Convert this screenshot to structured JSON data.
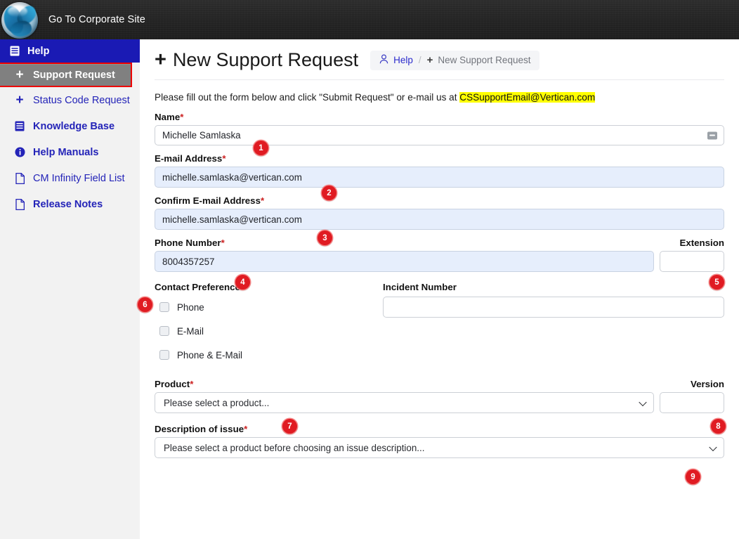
{
  "topbar": {
    "logo_icon": "vertican-sphere-logo",
    "corporate_link": "Go To Corporate Site"
  },
  "sidebar": {
    "header": {
      "label": "Help",
      "icon": "book-icon"
    },
    "items": [
      {
        "label": "Support Request",
        "icon": "plus-icon",
        "active": true,
        "bold": true
      },
      {
        "label": "Status Code Request",
        "icon": "plus-icon",
        "active": false,
        "bold": false
      },
      {
        "label": "Knowledge Base",
        "icon": "book-icon",
        "active": false,
        "bold": true
      },
      {
        "label": "Help Manuals",
        "icon": "info-icon",
        "active": false,
        "bold": true
      },
      {
        "label": "CM Infinity Field List",
        "icon": "document-icon",
        "active": false,
        "bold": false
      },
      {
        "label": "Release Notes",
        "icon": "document-icon",
        "active": false,
        "bold": true
      }
    ]
  },
  "header": {
    "title": "New Support Request",
    "title_icon": "plus-icon",
    "breadcrumb": {
      "user_icon": "person-icon",
      "parent": "Help",
      "separator": "/",
      "current_icon": "plus-icon",
      "current": "New Support Request"
    }
  },
  "form": {
    "intro_before": "Please fill out the form below and click \"Submit Request\" or e-mail us at ",
    "intro_email": "CSSupportEmail@Vertican.com",
    "name": {
      "label": "Name",
      "required": "*",
      "value": "Michelle Samlaska",
      "autofill_icon": "credentials-icon"
    },
    "email": {
      "label": "E-mail Address",
      "required": "*",
      "value": "michelle.samlaska@vertican.com"
    },
    "confirm_email": {
      "label": "Confirm E-mail Address",
      "required": "*",
      "value": "michelle.samlaska@vertican.com"
    },
    "phone": {
      "label": "Phone Number",
      "required": "*",
      "value": "8004357257"
    },
    "extension": {
      "label": "Extension",
      "value": ""
    },
    "contact_preference": {
      "label": "Contact Preference",
      "options": [
        {
          "label": "Phone",
          "checked": false
        },
        {
          "label": "E-Mail",
          "checked": false
        },
        {
          "label": "Phone & E-Mail",
          "checked": false
        }
      ]
    },
    "incident_number": {
      "label": "Incident Number",
      "value": ""
    },
    "product": {
      "label": "Product",
      "required": "*",
      "selected": "Please select a product..."
    },
    "version": {
      "label": "Version",
      "value": ""
    },
    "description": {
      "label": "Description of issue",
      "required": "*",
      "selected": "Please select a product before choosing an issue description..."
    }
  },
  "annotations": [
    {
      "n": "1",
      "target": "name-field"
    },
    {
      "n": "2",
      "target": "email-field"
    },
    {
      "n": "3",
      "target": "confirm-email-field"
    },
    {
      "n": "4",
      "target": "phone-field"
    },
    {
      "n": "5",
      "target": "extension-field"
    },
    {
      "n": "6",
      "target": "contact-preference-label"
    },
    {
      "n": "7",
      "target": "product-select"
    },
    {
      "n": "8",
      "target": "version-field"
    },
    {
      "n": "9",
      "target": "description-select"
    }
  ],
  "colors": {
    "topbar": "#262626",
    "sidebar_header": "#1a1ab4",
    "sidebar_bg": "#f2f2f2",
    "active_item": "#808080",
    "active_outline": "#ee0000",
    "link_blue": "#2424b8",
    "badge_red": "#e01b22",
    "highlight_yellow": "#ffff00",
    "autofill_blue": "#e6eefc"
  }
}
